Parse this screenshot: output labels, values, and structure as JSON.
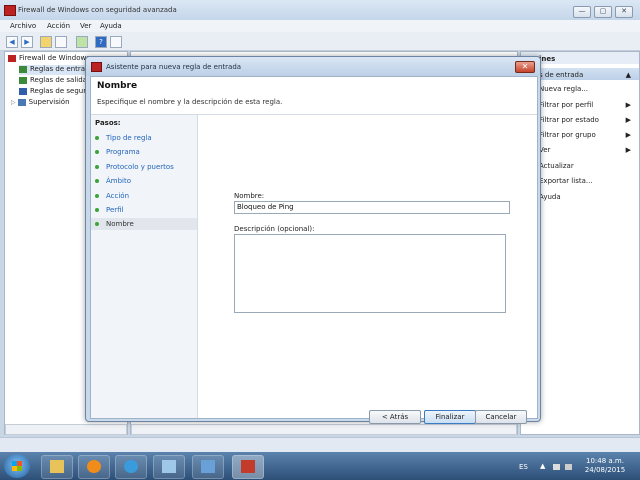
{
  "main_window": {
    "title": "Firewall de Windows con seguridad avanzada",
    "menu": [
      "Archivo",
      "Acción",
      "Ver",
      "Ayuda"
    ],
    "window_controls": {
      "minimize": "—",
      "maximize": "▢",
      "close": "✕"
    }
  },
  "left_tree": {
    "items": [
      {
        "label": "Firewall de Windows",
        "icon": "firewall-icon",
        "indent": 0
      },
      {
        "label": "Reglas de entrada",
        "icon": "inbound-rules-icon",
        "indent": 1
      },
      {
        "label": "Reglas de salida",
        "icon": "outbound-rules-icon",
        "indent": 1
      },
      {
        "label": "Reglas de segur",
        "icon": "security-rules-icon",
        "indent": 1
      },
      {
        "label": "Supervisión",
        "icon": "monitoring-icon",
        "indent": 1
      }
    ]
  },
  "actions_pane": {
    "header": "ines",
    "section": "s de entrada",
    "items": [
      {
        "label": "Nueva regla...",
        "submenu": false
      },
      {
        "label": "Filtrar por perfil",
        "submenu": true
      },
      {
        "label": "Filtrar por estado",
        "submenu": true
      },
      {
        "label": "Filtrar por grupo",
        "submenu": true
      },
      {
        "label": "Ver",
        "submenu": true
      },
      {
        "label": "Actualizar",
        "submenu": false
      },
      {
        "label": "Exportar lista...",
        "submenu": false
      },
      {
        "label": "Ayuda",
        "submenu": false
      }
    ]
  },
  "dialog": {
    "title": "Asistente para nueva regla de entrada",
    "heading": "Nombre",
    "subheading": "Especifique el nombre y la descripción de esta regla.",
    "steps_label": "Pasos:",
    "steps": [
      "Tipo de regla",
      "Programa",
      "Protocolo y puertos",
      "Ámbito",
      "Acción",
      "Perfil",
      "Nombre"
    ],
    "current_step": "Nombre",
    "name_label": "Nombre:",
    "name_value": "Bloqueo de Ping",
    "description_label": "Descripción (opcional):",
    "description_value": "",
    "buttons": {
      "back": "< Atrás",
      "finish": "Finalizar",
      "cancel": "Cancelar"
    },
    "close_glyph": "✕"
  },
  "taskbar": {
    "language": "ES",
    "time": "10:48 a.m.",
    "date": "24/08/2015"
  }
}
